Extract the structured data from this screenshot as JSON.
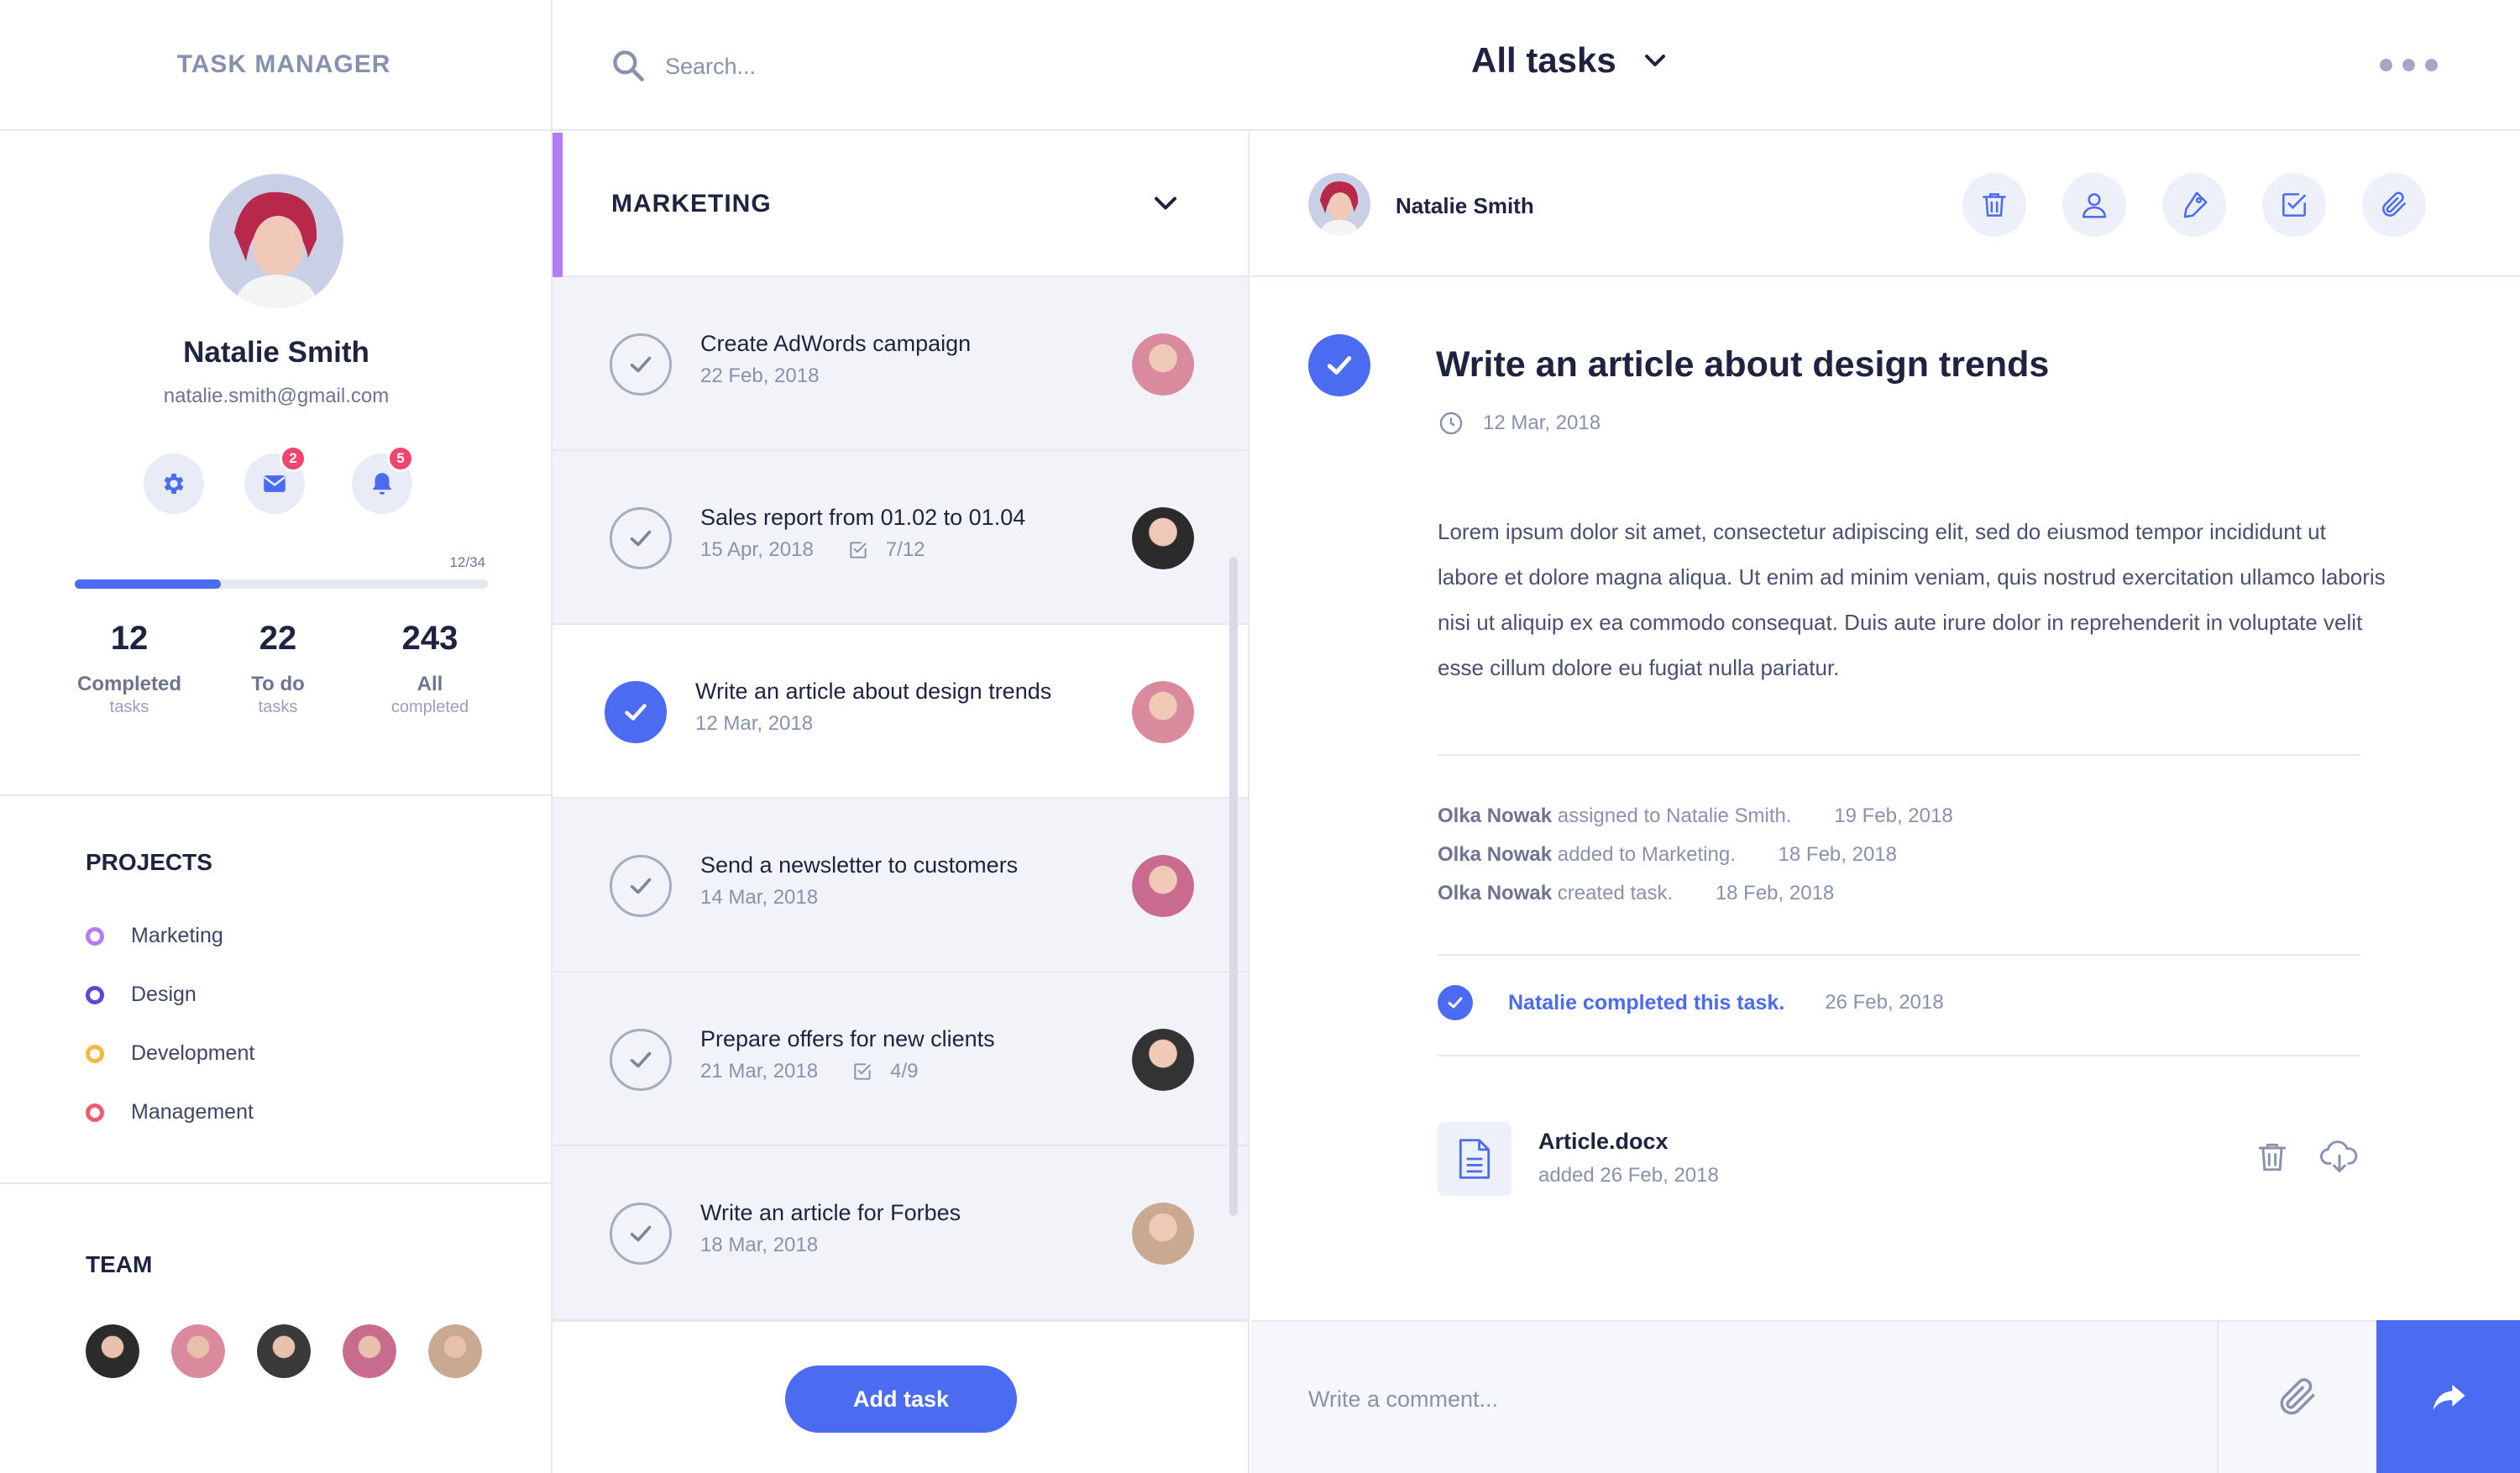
{
  "app": {
    "title": "TASK MANAGER"
  },
  "profile": {
    "name": "Natalie Smith",
    "email": "natalie.smith@gmail.com",
    "icons": [
      {
        "name": "settings",
        "icon": "gear-icon",
        "badge": ""
      },
      {
        "name": "messages",
        "icon": "mail-icon",
        "badge": "2"
      },
      {
        "name": "notifications",
        "icon": "bell-icon",
        "badge": "5"
      }
    ],
    "progress_label": "12/34",
    "progress_fraction": 0.3529,
    "stats": [
      {
        "value": "12",
        "label": "Completed",
        "sub": "tasks"
      },
      {
        "value": "22",
        "label": "To do",
        "sub": "tasks"
      },
      {
        "value": "243",
        "label": "All",
        "sub": "completed"
      }
    ]
  },
  "projects": {
    "title": "PROJECTS",
    "items": [
      {
        "label": "Marketing",
        "color": "#b57bf3"
      },
      {
        "label": "Design",
        "color": "#5b49d6"
      },
      {
        "label": "Development",
        "color": "#f5b942"
      },
      {
        "label": "Management",
        "color": "#f25a6e"
      }
    ]
  },
  "team": {
    "title": "TEAM",
    "members": [
      {
        "name": "member-1",
        "color": "#2b2b2b"
      },
      {
        "name": "member-2",
        "color": "#d98a9c"
      },
      {
        "name": "member-3",
        "color": "#3a3a3a"
      },
      {
        "name": "member-4",
        "color": "#c86b8e"
      },
      {
        "name": "member-5",
        "color": "#c9a98f"
      }
    ]
  },
  "topbar": {
    "search_placeholder": "Search...",
    "view_label": "All tasks"
  },
  "task_list": {
    "project_label": "MARKETING",
    "tasks": [
      {
        "title": "Create AdWords campaign",
        "date": "22 Feb, 2018",
        "subtasks": "",
        "done": false,
        "active": false,
        "avatar_color": "#d98a9c"
      },
      {
        "title": "Sales report from 01.02 to 01.04",
        "date": "15 Apr, 2018",
        "subtasks": "7/12",
        "done": false,
        "active": false,
        "avatar_color": "#2b2b2b"
      },
      {
        "title": "Write an article about design trends",
        "date": "12 Mar, 2018",
        "subtasks": "",
        "done": true,
        "active": true,
        "avatar_color": "#d98a9c"
      },
      {
        "title": "Send a newsletter to customers",
        "date": "14 Mar, 2018",
        "subtasks": "",
        "done": false,
        "active": false,
        "avatar_color": "#c86b8e"
      },
      {
        "title": "Prepare offers for new clients",
        "date": "21 Mar, 2018",
        "subtasks": "4/9",
        "done": false,
        "active": false,
        "avatar_color": "#333333"
      },
      {
        "title": "Write an article for Forbes",
        "date": "18 Mar, 2018",
        "subtasks": "",
        "done": false,
        "active": false,
        "avatar_color": "#c9a98f"
      }
    ],
    "add_task_label": "Add task"
  },
  "detail": {
    "assignee": "Natalie Smith",
    "actions": [
      "trash-icon",
      "user-icon",
      "tag-icon",
      "checkbox-icon",
      "paperclip-icon"
    ],
    "title": "Write an article about design trends",
    "date": "12 Mar, 2018",
    "body": "Lorem ipsum dolor sit amet, consectetur adipiscing elit, sed do eiusmod tempor incididunt ut labore et dolore magna aliqua. Ut enim ad minim veniam, quis nostrud exercitation ullamco laboris nisi ut aliquip ex ea commodo consequat. Duis aute irure dolor in reprehenderit in voluptate velit esse cillum dolore eu fugiat nulla pariatur.",
    "activity": [
      {
        "who": "Olka Nowak",
        "action": "assigned to Natalie Smith.",
        "date": "19 Feb, 2018"
      },
      {
        "who": "Olka Nowak",
        "action": "added to Marketing.",
        "date": "18 Feb, 2018"
      },
      {
        "who": "Olka Nowak",
        "action": "created task.",
        "date": "18 Feb, 2018"
      }
    ],
    "completed_text": "Natalie completed this task.",
    "completed_date": "26 Feb, 2018",
    "file": {
      "name": "Article.docx",
      "added": "added 26 Feb, 2018"
    },
    "comment_placeholder": "Write a comment..."
  },
  "colors": {
    "accent": "#4b6bf1",
    "badge": "#f1446f",
    "project_accent": "#b57bf3"
  }
}
